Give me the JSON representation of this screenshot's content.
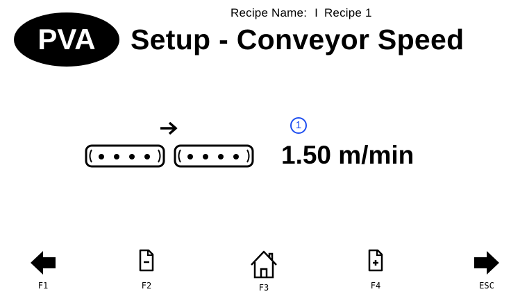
{
  "brand": {
    "logo_text": "PVA"
  },
  "header": {
    "recipe_label": "Recipe Name:",
    "recipe_separator": "I",
    "recipe_value": "Recipe 1",
    "title": "Setup - Conveyor Speed"
  },
  "conveyor": {
    "direction_icon": "arrow-right-icon",
    "info_number": "1",
    "speed_value": "1.50 m/min"
  },
  "function_keys": [
    {
      "label": "F1",
      "icon": "arrow-left-icon"
    },
    {
      "label": "F2",
      "icon": "document-minus-icon"
    },
    {
      "label": "F3",
      "icon": "home-icon"
    },
    {
      "label": "F4",
      "icon": "document-plus-icon"
    },
    {
      "label": "ESC",
      "icon": "arrow-right-icon"
    }
  ],
  "colors": {
    "background": "#ffffff",
    "text": "#000000",
    "info_accent": "#1f4ff0"
  }
}
